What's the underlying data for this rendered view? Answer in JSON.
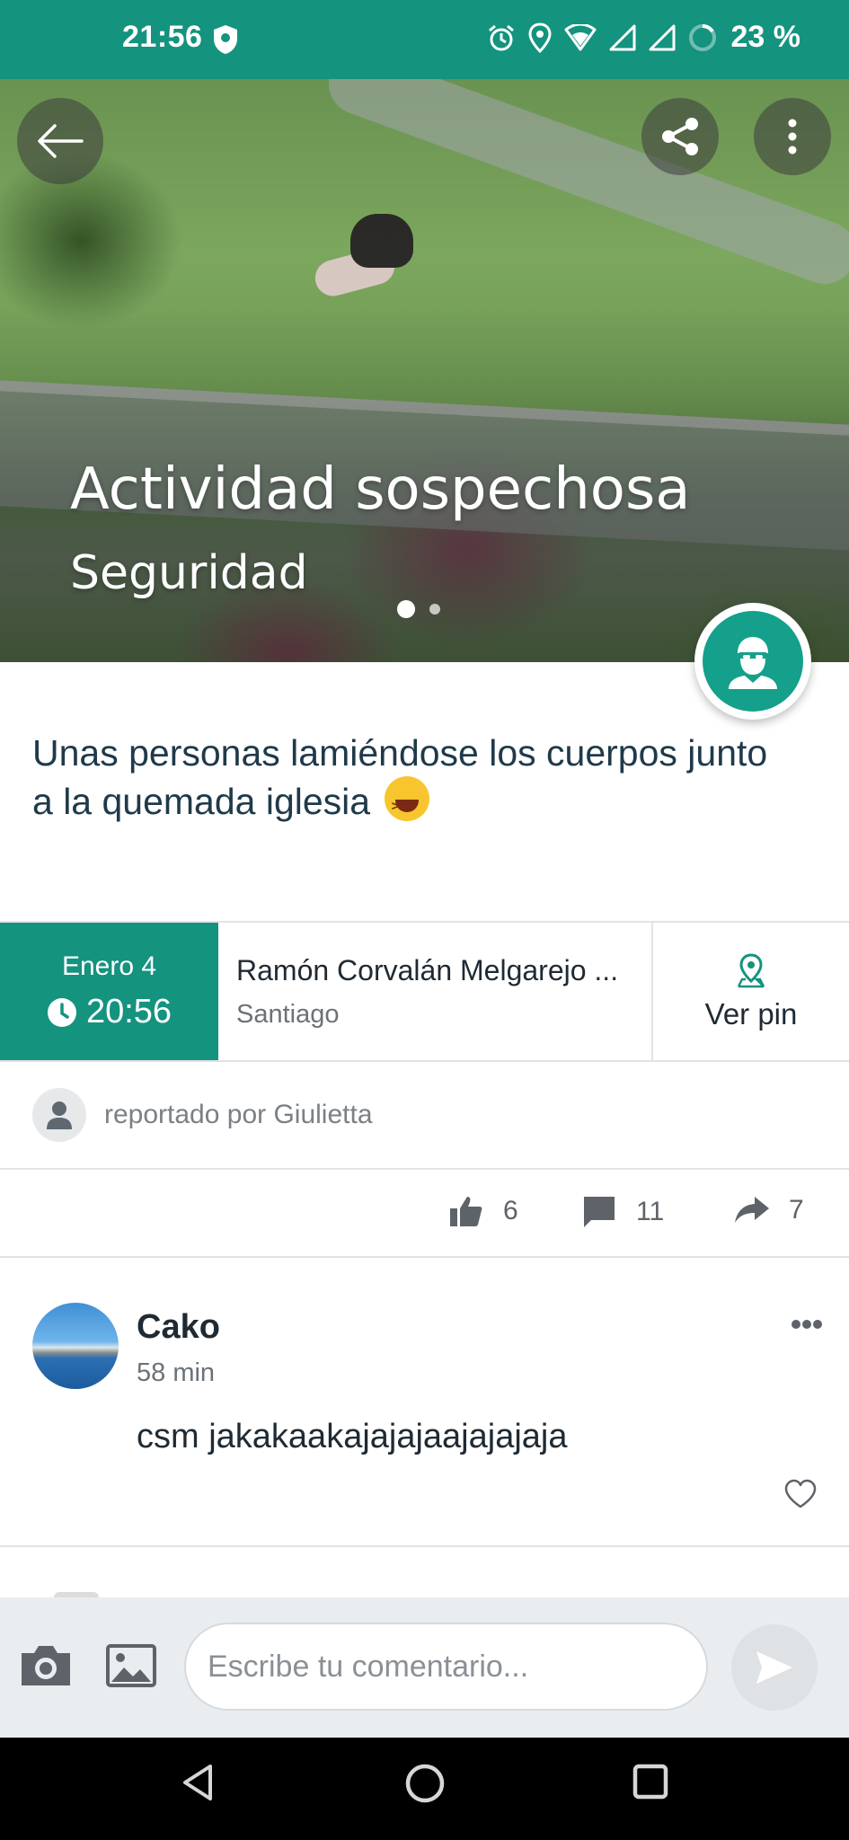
{
  "status_bar": {
    "time": "21:56",
    "battery": "23 %",
    "icons": [
      "shield-icon",
      "alarm-icon",
      "location-icon",
      "wifi-icon",
      "signal-icon",
      "signal-icon",
      "battery-icon"
    ]
  },
  "hero": {
    "title": "Actividad sospechosa",
    "subtitle": "Seguridad",
    "page_count": 2,
    "active_page": 1
  },
  "category_icon": "masked-person-icon",
  "description": "Unas personas lamiéndose los cuerpos junto a la quemada iglesia",
  "description_emoji": "grinning-squinting-face",
  "info": {
    "date": "Enero 4",
    "time": "20:56",
    "street": "Ramón Corvalán Melgarejo ...",
    "city": "Santiago",
    "pin_label": "Ver pin"
  },
  "reporter": {
    "text": "reportado por Giulietta"
  },
  "stats": {
    "likes": "6",
    "comments": "11",
    "shares": "7"
  },
  "comments": [
    {
      "author": "Cako",
      "time": "58 min",
      "text": "csm jakakaakajajajaajajajaja"
    }
  ],
  "composer": {
    "placeholder": "Escribe tu comentario..."
  },
  "colors": {
    "primary": "#14937f",
    "badge": "#14a08b"
  }
}
